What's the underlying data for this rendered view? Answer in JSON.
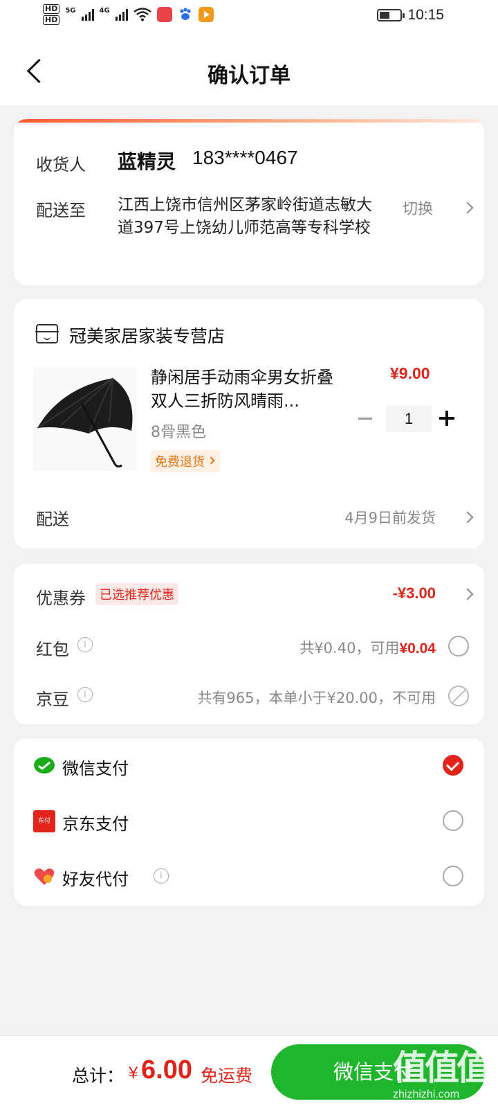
{
  "status_bar": {
    "hd1": "HD",
    "hd2": "HD",
    "net1": "5G",
    "net2": "4G",
    "time": "10:15"
  },
  "nav": {
    "title": "确认订单"
  },
  "address": {
    "receiver_label": "收货人",
    "receiver_name": "蓝精灵",
    "receiver_phone": "183****0467",
    "ship_label": "配送至",
    "ship_address": "江西上饶市信州区茅家岭街道志敏大道397号上饶幼儿师范高等专科学校",
    "switch_label": "切换"
  },
  "shop": {
    "name": "冠美家居家装专营店",
    "product": {
      "title": "静闲居手动雨伞男女折叠双人三折防风晴雨...",
      "variant": "8骨黑色",
      "return_badge": "免费退货",
      "price": "¥9.00",
      "quantity": "1"
    },
    "delivery_label": "配送",
    "delivery_value": "4月9日前发货"
  },
  "discounts": {
    "coupon_label": "优惠券",
    "coupon_tag": "已选推荐优惠",
    "coupon_value": "-¥3.00",
    "redpack_label": "红包",
    "redpack_text": "共¥0.40，可用",
    "redpack_available": "¥0.04",
    "bean_label": "京豆",
    "bean_text": "共有965，本单小于¥20.00，不可用"
  },
  "payment": {
    "options": [
      {
        "label": "微信支付",
        "icon": "wechat-icon",
        "selected": true
      },
      {
        "label": "京东支付",
        "icon": "jd-pay-icon",
        "icon_text": "东付",
        "selected": false
      },
      {
        "label": "好友代付",
        "icon": "heart-icon",
        "selected": false
      }
    ]
  },
  "bottom": {
    "total_label": "总计：",
    "currency": "¥",
    "total_value": "6.00",
    "free_shipping": "免运费",
    "pay_button": "微信支付",
    "watermark_big": "值值值",
    "watermark_small": "zhizhizhi.com"
  },
  "colors": {
    "accent_red": "#e2231a",
    "wechat_green": "#1fb52c",
    "orange": "#e8740c"
  }
}
